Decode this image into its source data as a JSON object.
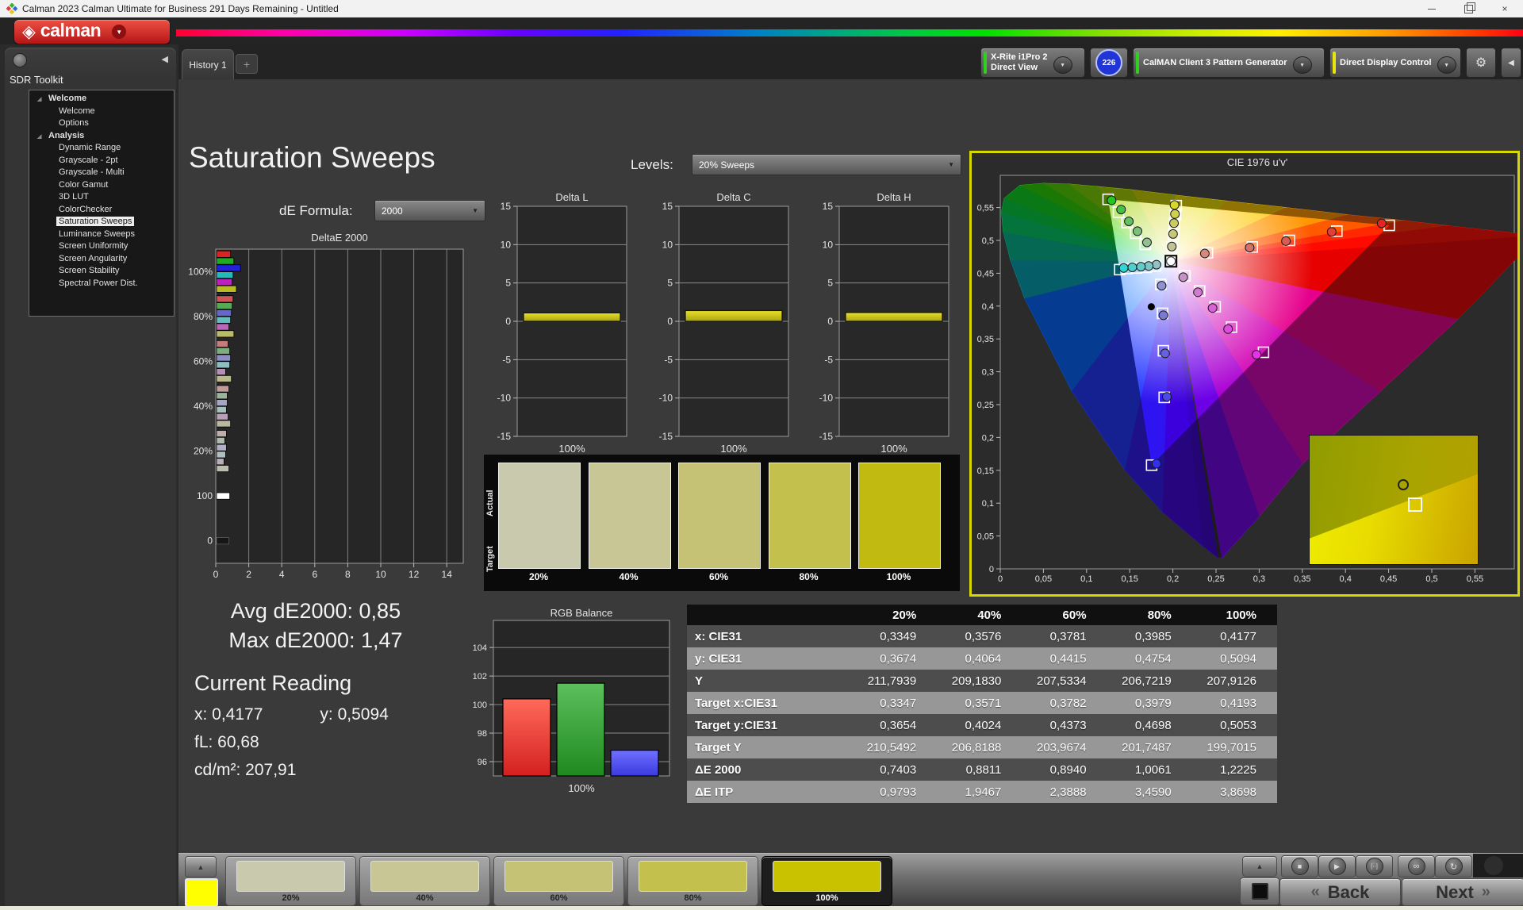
{
  "window": {
    "title": "Calman 2023 Calman Ultimate for Business 291 Days Remaining  - Untitled"
  },
  "brand": {
    "logo_text": "calman"
  },
  "icons": {
    "dropdown": "▼",
    "collapse_left": "◀",
    "gear": "⚙",
    "tab_add": "+",
    "tree_expand": "◢",
    "up_arrow": "▲",
    "stop": "■",
    "play": "▶",
    "step": "[··]",
    "loop": "∞",
    "refresh": "↻",
    "back_chev": "«",
    "next_chev": "»",
    "close": "×",
    "logo_diamond": "◈"
  },
  "tabs": {
    "history": "History 1"
  },
  "toolbar": {
    "meter": {
      "line1": "X-Rite i1Pro 2",
      "line2": "Direct View",
      "status_color": "#2fd01e",
      "badge": "226"
    },
    "pattern": {
      "label": "CalMAN Client 3 Pattern Generator",
      "status_color": "#2fd01e"
    },
    "display": {
      "label": "Direct Display Control",
      "status_color": "#e8e50a"
    }
  },
  "sidebar": {
    "title": "SDR Toolkit",
    "selected": "Saturation Sweeps",
    "groups": [
      {
        "label": "Welcome",
        "items": [
          "Welcome",
          "Options"
        ]
      },
      {
        "label": "Analysis",
        "items": [
          "Dynamic Range",
          "Grayscale - 2pt",
          "Grayscale - Multi",
          "Color Gamut",
          "3D LUT",
          "ColorChecker",
          "Saturation Sweeps",
          "Luminance Sweeps",
          "Screen Uniformity",
          "Screen Angularity",
          "Screen Stability",
          "Spectral Power Dist."
        ]
      }
    ]
  },
  "page": {
    "title": "Saturation Sweeps",
    "levels_label": "Levels:",
    "levels_value": "20% Sweeps",
    "de_label": "dE Formula:",
    "de_value": "2000"
  },
  "stats": {
    "avg": "Avg dE2000: 0,85",
    "max": "Max dE2000: 1,47",
    "current_title": "Current Reading",
    "x": "x: 0,4177",
    "y": "y: 0,5094",
    "fl": "fL: 60,68",
    "cd": "cd/m²: 207,91"
  },
  "swatch_panel": {
    "actual": "Actual",
    "target": "Target",
    "labels": [
      "20%",
      "40%",
      "60%",
      "80%",
      "100%"
    ],
    "colors": [
      "#c9c9ae",
      "#c8c694",
      "#c5c175",
      "#c4c04e",
      "#c1ba10"
    ]
  },
  "table": {
    "headers": [
      "",
      "20%",
      "40%",
      "60%",
      "80%",
      "100%"
    ],
    "rows": [
      [
        "x: CIE31",
        "0,3349",
        "0,3576",
        "0,3781",
        "0,3985",
        "0,4177"
      ],
      [
        "y: CIE31",
        "0,3674",
        "0,4064",
        "0,4415",
        "0,4754",
        "0,5094"
      ],
      [
        "Y",
        "211,7939",
        "209,1830",
        "207,5334",
        "206,7219",
        "207,9126"
      ],
      [
        "Target x:CIE31",
        "0,3347",
        "0,3571",
        "0,3782",
        "0,3979",
        "0,4193"
      ],
      [
        "Target y:CIE31",
        "0,3654",
        "0,4024",
        "0,4373",
        "0,4698",
        "0,5053"
      ],
      [
        "Target Y",
        "210,5492",
        "206,8188",
        "203,9674",
        "201,7487",
        "199,7015"
      ],
      [
        "ΔE 2000",
        "0,7403",
        "0,8811",
        "0,8940",
        "1,0061",
        "1,2225"
      ],
      [
        "ΔE ITP",
        "0,9793",
        "1,9467",
        "2,3888",
        "3,4590",
        "3,8698"
      ]
    ]
  },
  "bottom": {
    "labels": [
      "20%",
      "40%",
      "60%",
      "80%",
      "100%"
    ],
    "colors": [
      "#c9c9ae",
      "#c8c694",
      "#c5c175",
      "#c4c04e",
      "#c8c200"
    ],
    "selected_index": 4,
    "mini_color": "#ffff00",
    "back": "Back",
    "next": "Next"
  },
  "chart_data": [
    {
      "id": "deltae2000",
      "type": "bar",
      "orientation": "horizontal",
      "title": "DeltaE 2000",
      "xlim": [
        0,
        15
      ],
      "xticks": [
        0,
        2,
        4,
        6,
        8,
        10,
        12,
        14
      ],
      "categories": [
        "100%",
        "80%",
        "60%",
        "40%",
        "20%",
        "100",
        "0"
      ],
      "groups": [
        {
          "label": "100%",
          "bars": [
            {
              "c": "#dd2222",
              "v": 0.85
            },
            {
              "c": "#22aa22",
              "v": 1.05
            },
            {
              "c": "#2222dd",
              "v": 1.45
            },
            {
              "c": "#22bbbb",
              "v": 1.0
            },
            {
              "c": "#bb22bb",
              "v": 0.95
            },
            {
              "c": "#bbbb22",
              "v": 1.2
            }
          ]
        },
        {
          "label": "80%",
          "bars": [
            {
              "c": "#cc5555",
              "v": 1.0
            },
            {
              "c": "#55aa55",
              "v": 0.95
            },
            {
              "c": "#6666cc",
              "v": 0.9
            },
            {
              "c": "#66bbbb",
              "v": 0.85
            },
            {
              "c": "#bb66bb",
              "v": 0.75
            },
            {
              "c": "#bbbb66",
              "v": 1.05
            }
          ]
        },
        {
          "label": "60%",
          "bars": [
            {
              "c": "#c47d7d",
              "v": 0.7
            },
            {
              "c": "#7daf7d",
              "v": 0.8
            },
            {
              "c": "#8d8dc4",
              "v": 0.85
            },
            {
              "c": "#8dbfbf",
              "v": 0.8
            },
            {
              "c": "#b98db9",
              "v": 0.55
            },
            {
              "c": "#b9b98d",
              "v": 0.9
            }
          ]
        },
        {
          "label": "40%",
          "bars": [
            {
              "c": "#bf9b9b",
              "v": 0.75
            },
            {
              "c": "#9bb59b",
              "v": 0.65
            },
            {
              "c": "#a5a5c4",
              "v": 0.65
            },
            {
              "c": "#a5bfbf",
              "v": 0.6
            },
            {
              "c": "#b9a0b9",
              "v": 0.7
            },
            {
              "c": "#b9b9a0",
              "v": 0.85
            }
          ]
        },
        {
          "label": "20%",
          "bars": [
            {
              "c": "#bfaeae",
              "v": 0.6
            },
            {
              "c": "#aebbae",
              "v": 0.5
            },
            {
              "c": "#b0b0c4",
              "v": 0.6
            },
            {
              "c": "#aebfbf",
              "v": 0.55
            },
            {
              "c": "#b9aeb9",
              "v": 0.45
            },
            {
              "c": "#bcbcae",
              "v": 0.75
            }
          ]
        },
        {
          "label": "100",
          "bars": [
            {
              "c": "#ffffff",
              "v": 0.8
            }
          ]
        },
        {
          "label": "0",
          "bars": [
            {
              "c": "#161616",
              "v": 0.75
            }
          ]
        }
      ]
    },
    {
      "id": "deltaL",
      "type": "bar",
      "title": "Delta L",
      "categories": [
        "100%"
      ],
      "values": [
        1.1
      ],
      "ylim": [
        -15,
        15
      ],
      "yticks": [
        15,
        10,
        5,
        0,
        -5,
        -10,
        -15
      ],
      "bar_color_top": "#e8e22a",
      "bar_color_bot": "#aaa410"
    },
    {
      "id": "deltaC",
      "type": "bar",
      "title": "Delta C",
      "categories": [
        "100%"
      ],
      "values": [
        1.4
      ],
      "ylim": [
        -15,
        15
      ],
      "yticks": [
        15,
        10,
        5,
        0,
        -5,
        -10,
        -15
      ],
      "bar_color_top": "#e8e22a",
      "bar_color_bot": "#aaa410"
    },
    {
      "id": "deltaH",
      "type": "bar",
      "title": "Delta H",
      "categories": [
        "100%"
      ],
      "values": [
        1.15
      ],
      "ylim": [
        -15,
        15
      ],
      "yticks": [
        15,
        10,
        5,
        0,
        -5,
        -10,
        -15
      ],
      "bar_color_top": "#e8e22a",
      "bar_color_bot": "#aaa410"
    },
    {
      "id": "rgb_balance",
      "type": "bar",
      "title": "RGB Balance",
      "categories": [
        "100%"
      ],
      "yticks": [
        104,
        102,
        100,
        98,
        96
      ],
      "ylim": [
        95,
        105.9
      ],
      "series": [
        {
          "name": "Red",
          "value": 100.4,
          "c1": "#ff6a5a",
          "c2": "#d42020"
        },
        {
          "name": "Green",
          "value": 101.5,
          "c1": "#5cc05c",
          "c2": "#1f8a1f"
        },
        {
          "name": "Blue",
          "value": 96.8,
          "c1": "#7070ff",
          "c2": "#3a3ae0"
        }
      ]
    },
    {
      "id": "cie1976",
      "type": "scatter",
      "title": "CIE 1976 u'v'",
      "xlim": [
        0,
        0.6
      ],
      "ylim": [
        0,
        0.6
      ],
      "xtick_labels": [
        "0",
        "0,05",
        "0,1",
        "0,15",
        "0,2",
        "0,25",
        "0,3",
        "0,35",
        "0,4",
        "0,45",
        "0,5",
        "0,55"
      ],
      "ytick_labels": [
        "0",
        "0,05",
        "0,1",
        "0,15",
        "0,2",
        "0,25",
        "0,3",
        "0,35",
        "0,4",
        "0,45",
        "0,5",
        "0,55"
      ],
      "white_point": [
        0.1978,
        0.4683
      ],
      "extra_dot": [
        0.175,
        0.399
      ],
      "gamut_triangle": [
        [
          0.4507,
          0.5229
        ],
        [
          0.125,
          0.5625
        ],
        [
          0.1754,
          0.1579
        ]
      ],
      "locus": [
        [
          0.2522,
          0.017,
          "#3a00c8"
        ],
        [
          0.2347,
          0.035,
          "#3c00dc"
        ],
        [
          0.1877,
          0.087,
          "#2e14f0"
        ],
        [
          0.1441,
          0.151,
          "#1e32ff"
        ],
        [
          0.0828,
          0.271,
          "#0064ff"
        ],
        [
          0.0282,
          0.412,
          "#00a0b4"
        ],
        [
          0.0119,
          0.47,
          "#00b48c"
        ],
        [
          0.0035,
          0.513,
          "#00c864"
        ],
        [
          0.0014,
          0.543,
          "#00cd3c"
        ],
        [
          0.0046,
          0.564,
          "#0ad21e"
        ],
        [
          0.0231,
          0.584,
          "#28d200"
        ],
        [
          0.0501,
          0.587,
          "#50d200"
        ],
        [
          0.0792,
          0.586,
          "#7dd200"
        ],
        [
          0.1127,
          0.582,
          "#a5d200"
        ],
        [
          0.1531,
          0.577,
          "#cdd200"
        ],
        [
          0.2026,
          0.569,
          "#ebdc00"
        ],
        [
          0.2623,
          0.56,
          "#ffc800"
        ],
        [
          0.3315,
          0.55,
          "#ff9600"
        ],
        [
          0.4035,
          0.539,
          "#ff5a00"
        ],
        [
          0.4691,
          0.53,
          "#ff2800"
        ],
        [
          0.5203,
          0.522,
          "#ff0a00"
        ],
        [
          0.6234,
          0.507,
          "#e60000"
        ],
        [
          0.53,
          0.38,
          "#e6008c"
        ],
        [
          0.44,
          0.27,
          "#d200b4"
        ],
        [
          0.35,
          0.16,
          "#aa00d2"
        ],
        [
          0.3,
          0.08,
          "#6e00e6"
        ],
        [
          0.2568,
          0.017,
          "#4600d2"
        ]
      ],
      "sweeps": [
        {
          "name": "red",
          "point_colors": [
            "#d4897e",
            "#d8706a",
            "#dc5a52",
            "#e0403a",
            "#e42622"
          ],
          "targets": [
            [
              0.24,
              0.481
            ],
            [
              0.292,
              0.49
            ],
            [
              0.335,
              0.5
            ],
            [
              0.39,
              0.514
            ],
            [
              0.4507,
              0.5229
            ]
          ],
          "measured": [
            [
              0.237,
              0.48
            ],
            [
              0.289,
              0.489
            ],
            [
              0.331,
              0.499
            ],
            [
              0.384,
              0.513
            ],
            [
              0.442,
              0.526
            ]
          ]
        },
        {
          "name": "green",
          "point_colors": [
            "#92c092",
            "#7cc07c",
            "#62c162",
            "#46c146",
            "#22c822"
          ],
          "targets": [
            [
              0.168,
              0.494
            ],
            [
              0.157,
              0.511
            ],
            [
              0.147,
              0.527
            ],
            [
              0.137,
              0.543
            ],
            [
              0.125,
              0.5625
            ]
          ],
          "measured": [
            [
              0.17,
              0.497
            ],
            [
              0.159,
              0.514
            ],
            [
              0.149,
              0.529
            ],
            [
              0.14,
              0.547
            ],
            [
              0.129,
              0.561
            ]
          ]
        },
        {
          "name": "blue",
          "point_colors": [
            "#9191d0",
            "#7a7ad6",
            "#6363dd",
            "#4c4ce4",
            "#3030ee"
          ],
          "targets": [
            [
              0.186,
              0.433
            ],
            [
              0.188,
              0.389
            ],
            [
              0.189,
              0.332
            ],
            [
              0.19,
              0.261
            ],
            [
              0.1754,
              0.1579
            ]
          ],
          "measured": [
            [
              0.187,
              0.431
            ],
            [
              0.189,
              0.386
            ],
            [
              0.191,
              0.328
            ],
            [
              0.193,
              0.262
            ],
            [
              0.181,
              0.16
            ]
          ]
        },
        {
          "name": "cyan",
          "point_colors": [
            "#93c2c2",
            "#7cc6c6",
            "#64cbcb",
            "#4cd0d0",
            "#30d6d6"
          ],
          "targets": [
            [
              0.18,
              0.461
            ],
            [
              0.169,
              0.459
            ],
            [
              0.158,
              0.458
            ],
            [
              0.147,
              0.457
            ],
            [
              0.1384,
              0.4555
            ]
          ],
          "measured": [
            [
              0.181,
              0.463
            ],
            [
              0.172,
              0.461
            ],
            [
              0.163,
              0.46
            ],
            [
              0.153,
              0.459
            ],
            [
              0.143,
              0.458
            ]
          ]
        },
        {
          "name": "magenta",
          "point_colors": [
            "#c693c6",
            "#cf7ccf",
            "#d764d7",
            "#e04ce0",
            "#ea30ea"
          ],
          "targets": [
            [
              0.214,
              0.446
            ],
            [
              0.231,
              0.423
            ],
            [
              0.249,
              0.399
            ],
            [
              0.268,
              0.368
            ],
            [
              0.305,
              0.3297
            ]
          ],
          "measured": [
            [
              0.212,
              0.444
            ],
            [
              0.229,
              0.421
            ],
            [
              0.246,
              0.397
            ],
            [
              0.264,
              0.365
            ],
            [
              0.297,
              0.326
            ]
          ]
        },
        {
          "name": "yellow",
          "point_colors": [
            "#c2c293",
            "#c6c67c",
            "#cbcb64",
            "#d0d04c",
            "#d6d630"
          ],
          "targets": [
            [
              0.1994,
              0.4897
            ],
            [
              0.2008,
              0.5091
            ],
            [
              0.2019,
              0.5254
            ],
            [
              0.203,
              0.5392
            ],
            [
              0.2039,
              0.5529
            ]
          ],
          "measured": [
            [
              0.1988,
              0.4907
            ],
            [
              0.2002,
              0.5098
            ],
            [
              0.2013,
              0.5262
            ],
            [
              0.2024,
              0.5401
            ],
            [
              0.2019,
              0.5539
            ]
          ]
        }
      ],
      "inset": {
        "circle": [
          0.525,
          0.34
        ],
        "square": [
          0.585,
          0.48
        ]
      }
    }
  ]
}
